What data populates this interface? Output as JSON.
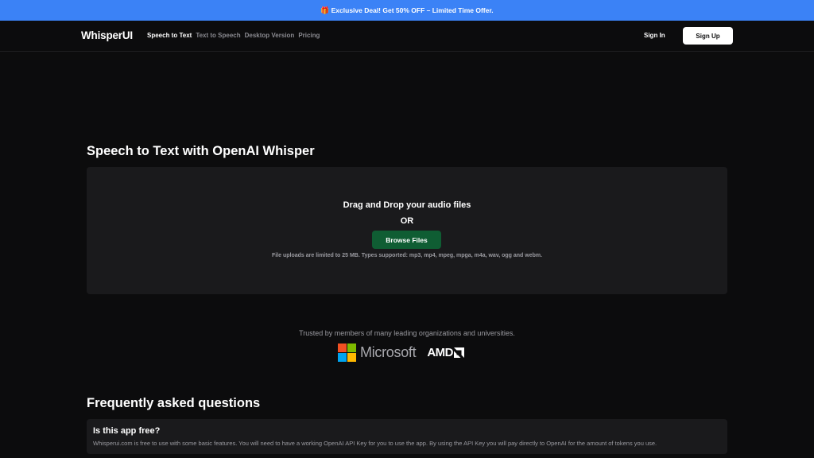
{
  "promo": {
    "icon": "gift-icon",
    "text": "Exclusive Deal! Get 50% OFF – Limited Time Offer."
  },
  "header": {
    "brand": "WhisperUI",
    "nav": [
      {
        "label": "Speech to Text",
        "active": true
      },
      {
        "label": "Text to Speech",
        "active": false
      },
      {
        "label": "Desktop Version",
        "active": false
      },
      {
        "label": "Pricing",
        "active": false
      }
    ],
    "sign_in": "Sign In",
    "sign_up": "Sign Up"
  },
  "main": {
    "title": "Speech to Text with OpenAI Whisper",
    "dropzone": {
      "title": "Drag and Drop your audio files",
      "or": "OR",
      "browse_label": "Browse Files",
      "note": "File uploads are limited to 25 MB. Types supported: mp3, mp4, mpeg, mpga, m4a, wav, ogg and webm."
    }
  },
  "trusted": {
    "text": "Trusted by members of many leading organizations and universities.",
    "logos": [
      {
        "name": "Microsoft",
        "icon": "microsoft-logo"
      },
      {
        "name": "AMD",
        "icon": "amd-logo"
      }
    ]
  },
  "faq": {
    "title": "Frequently asked questions",
    "items": [
      {
        "question": "Is this app free?",
        "answer": "Whisperui.com is free to use with some basic features. You will need to have a working OpenAI API Key for you to use the app. By using the API Key you will pay directly to OpenAI for the amount of tokens you use."
      }
    ]
  },
  "colors": {
    "background": "#0c0c0d",
    "promo_bar": "#3b82f6",
    "panel": "#1a1a1c",
    "browse_button": "#0f5d33",
    "muted_text": "#9a9aa0"
  }
}
